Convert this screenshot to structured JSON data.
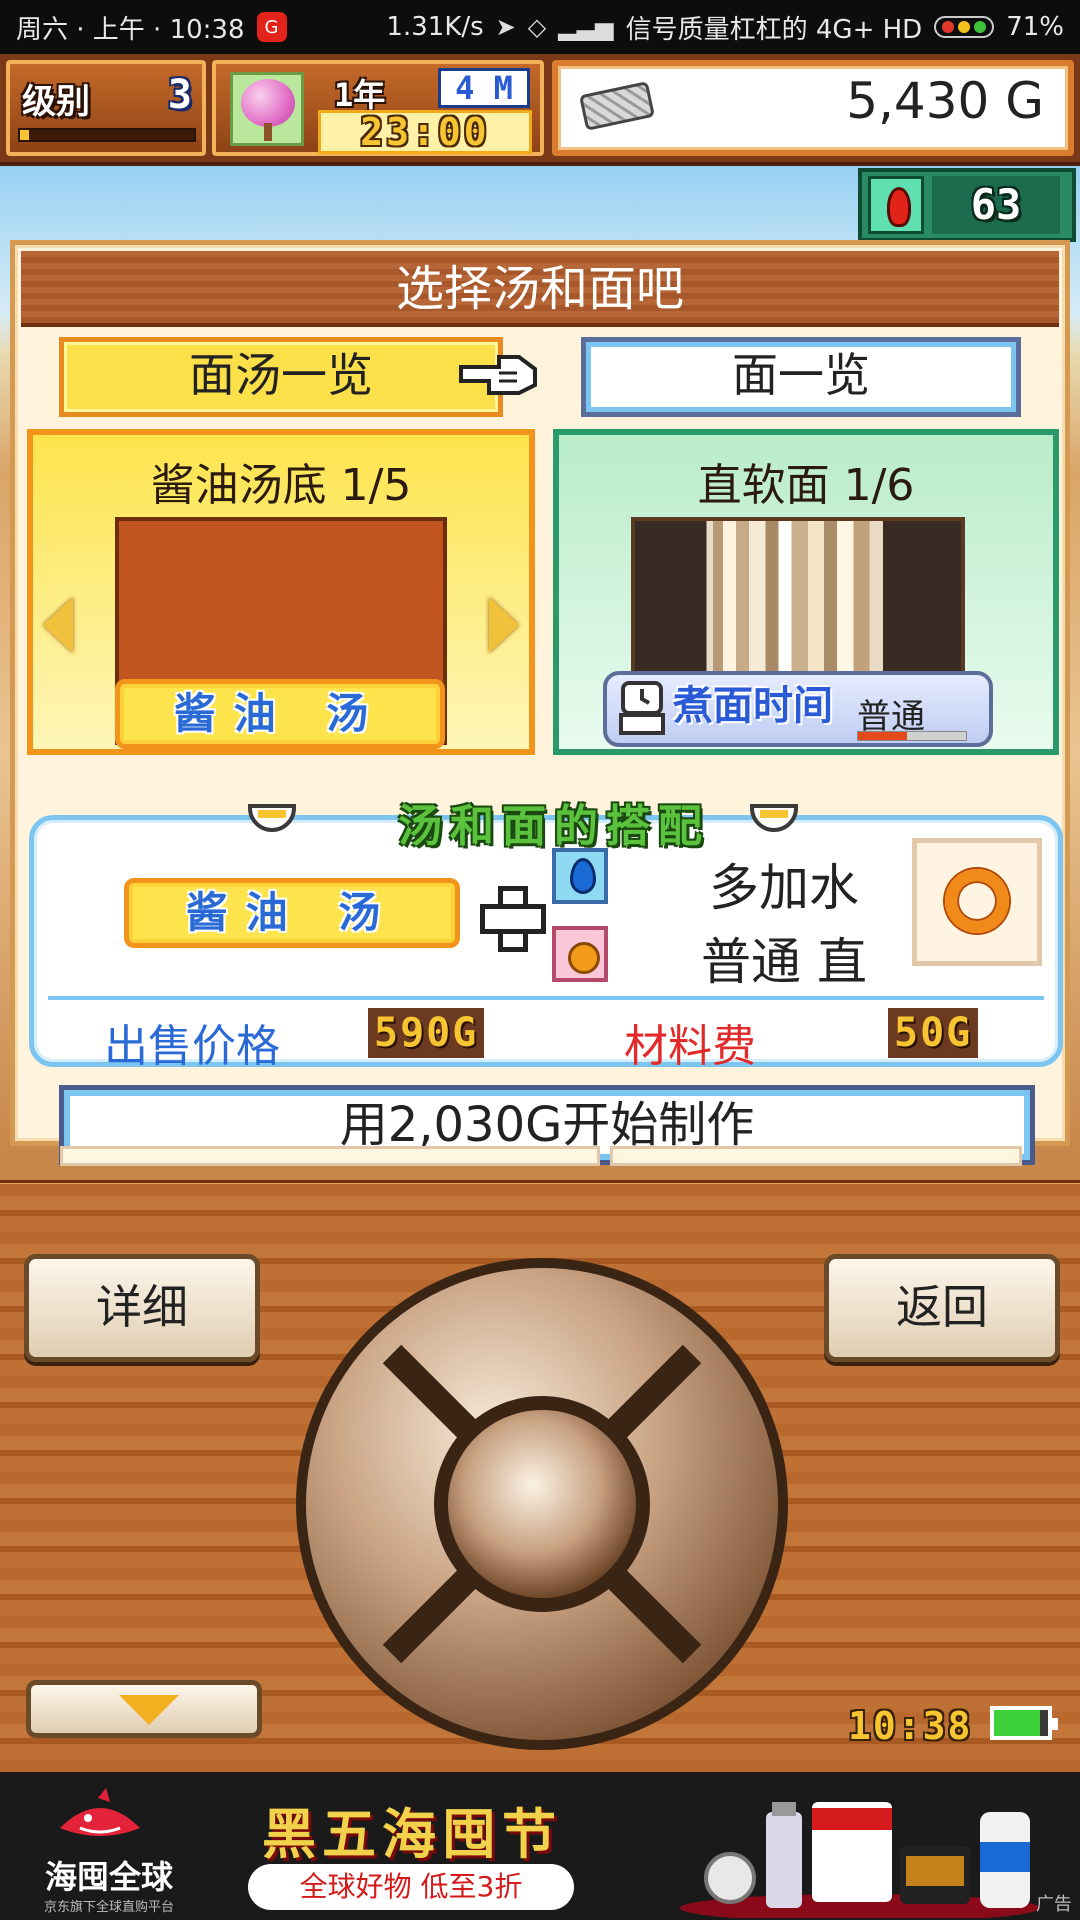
{
  "status_bar": {
    "left": "周六 · 上午 · 10:38",
    "app_badge": "G",
    "net_speed": "1.31K/s",
    "carrier": "信号质量杠杠的 4G+ HD",
    "battery": "71%"
  },
  "hud": {
    "level_label": "级别",
    "level": "3",
    "level_progress": 0.05,
    "year_label": "1年",
    "month": "4 M",
    "time": "23:00",
    "money": "5,430 G",
    "stamina": "63"
  },
  "dialog": {
    "title": "选择汤和面吧",
    "tab_soup": "面汤一览",
    "tab_noodle": "面一览",
    "soup_title": "酱油汤底 1/5",
    "soup_name": "酱油 汤",
    "noodle_title": "直软面 1/6",
    "cook_time_label": "煮面时间",
    "cook_time_value": "普通",
    "cook_time_level": 0.45,
    "combo_title": "汤和面的搭配",
    "combo_soup": "酱油 汤",
    "combo_water": "多加水",
    "combo_noodle": "普通 直",
    "price_label": "出售价格",
    "price_value": "590G",
    "cost_label": "材料费",
    "cost_value": "50G",
    "make_button": "用2,030G开始制作"
  },
  "controls": {
    "detail": "详细",
    "back": "返回",
    "clock": "10:38",
    "battery_level": 0.85
  },
  "ad": {
    "brand": "海囤全球",
    "brand_sub": "京东旗下全球直购平台",
    "title": "黑五海囤节",
    "subtitle": "全球好物 低至3折",
    "tag": "广告"
  },
  "colors": {
    "accent_yellow": "#fde44d",
    "accent_orange": "#f2941c",
    "accent_blue": "#2a6ad6",
    "accent_green": "#2a9a6a",
    "wood": "#b9692e"
  }
}
